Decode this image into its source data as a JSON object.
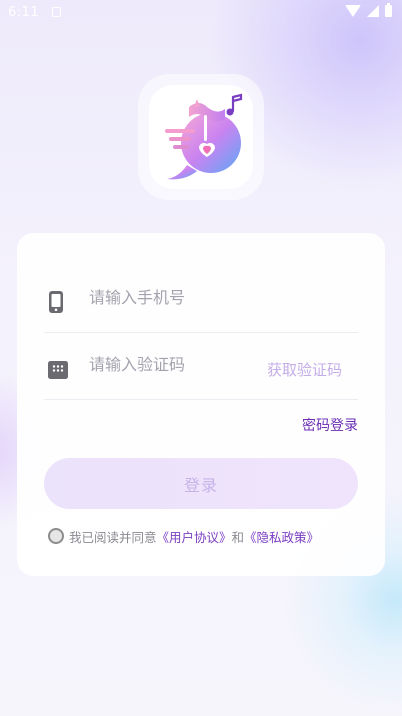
{
  "status_bar": {
    "time": "6:11"
  },
  "login": {
    "phone_placeholder": "请输入手机号",
    "code_placeholder": "请输入验证码",
    "get_code_label": "获取验证码",
    "password_login_label": "密码登录",
    "login_button_label": "登录",
    "agreement": {
      "prefix": "我已阅读并同意",
      "user_agreement": "《用户协议》",
      "and": "和",
      "privacy_policy": "《隐私政策》",
      "checked": false
    }
  },
  "colors": {
    "accent": "#6a2fb5",
    "link": "#7a3ec2",
    "get_code": "#c4aee8",
    "button_bg": "#ece2fb",
    "button_text": "#c6b3e8"
  },
  "icons": {
    "logo": "music-chat-logo",
    "phone": "mobile-phone-icon",
    "code": "keypad-icon"
  }
}
